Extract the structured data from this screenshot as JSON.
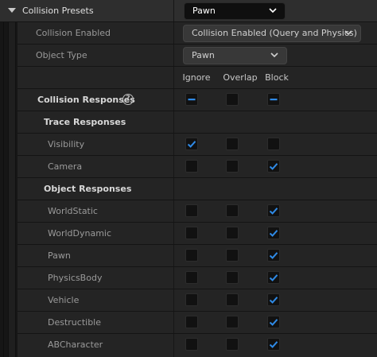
{
  "preset": {
    "title": "Collision Presets",
    "value": "Pawn"
  },
  "collision_enabled": {
    "label": "Collision Enabled",
    "value": "Collision Enabled (Query and Physics)"
  },
  "object_type": {
    "label": "Object Type",
    "value": "Pawn"
  },
  "columns": {
    "ignore": "Ignore",
    "overlap": "Overlap",
    "block": "Block"
  },
  "collision_responses": {
    "label": "Collision Responses",
    "help_icon": "question-circle-icon",
    "state": [
      "mixed",
      "none",
      "mixed"
    ]
  },
  "trace_responses": {
    "label": "Trace Responses",
    "items": [
      {
        "name": "Visibility",
        "state": "ignore"
      },
      {
        "name": "Camera",
        "state": "block"
      }
    ]
  },
  "object_responses": {
    "label": "Object Responses",
    "items": [
      {
        "name": "WorldStatic",
        "state": "block"
      },
      {
        "name": "WorldDynamic",
        "state": "block"
      },
      {
        "name": "Pawn",
        "state": "block"
      },
      {
        "name": "PhysicsBody",
        "state": "block"
      },
      {
        "name": "Vehicle",
        "state": "block"
      },
      {
        "name": "Destructible",
        "state": "block"
      },
      {
        "name": "ABCharacter",
        "state": "block"
      }
    ]
  },
  "colors": {
    "accent": "#2f8ae6",
    "panel": "#242424",
    "header": "#2e2e2e",
    "checkbox_bg": "#111111"
  }
}
